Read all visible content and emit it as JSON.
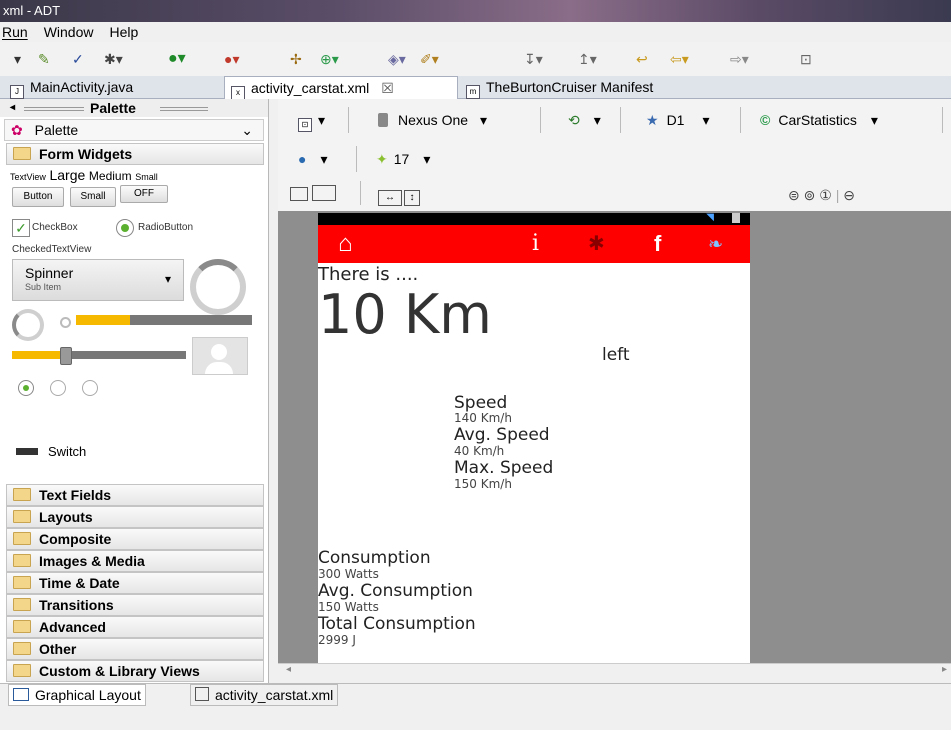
{
  "window": {
    "title": "xml - ADT"
  },
  "menu": {
    "items": [
      "Run",
      "Window",
      "Help"
    ]
  },
  "toolbar": {
    "icons": [
      "dropdown-arrow",
      "new-android-class-icon",
      "android-lint-icon",
      "debug-icon",
      "run-icon",
      "external-tools-icon",
      "new-project-icon",
      "new-class-icon",
      "open-type-icon",
      "search-icon",
      "next-annotation-icon",
      "prev-annotation-icon",
      "back-icon",
      "forward-icon",
      "pin-editor-icon"
    ]
  },
  "tabs": [
    {
      "label": "MainActivity.java",
      "icon": "J"
    },
    {
      "label": "activity_carstat.xml",
      "icon": "x",
      "close": "☒"
    },
    {
      "label": "TheBurtonCruiser Manifest",
      "icon": "m"
    }
  ],
  "palette": {
    "header": "Palette",
    "dropdown_label": "Palette",
    "open_category": "Form Widgets",
    "widgets": {
      "textview": "TextView",
      "large": "Large",
      "medium": "Medium",
      "small": "Small",
      "button": "Button",
      "small_button": "Small",
      "toggle": "OFF",
      "checkbox": "CheckBox",
      "radiobutton": "RadioButton",
      "checkedtextview": "CheckedTextView",
      "spinner": "Spinner",
      "spinner_sub": "Sub Item",
      "switch": "Switch"
    },
    "categories": [
      "Text Fields",
      "Layouts",
      "Composite",
      "Images & Media",
      "Time & Date",
      "Transitions",
      "Advanced",
      "Other",
      "Custom & Library Views"
    ]
  },
  "editor": {
    "device": "Nexus One",
    "theme": "D1",
    "activity": "CarStatistics",
    "api": "17"
  },
  "preview": {
    "header_line": "There is ....",
    "distance": "10 Km",
    "left_label": "left",
    "speed_label": "Speed",
    "speed_value": "140 Km/h",
    "avg_speed_label": "Avg. Speed",
    "avg_speed_value": "40 Km/h",
    "max_speed_label": "Max. Speed",
    "max_speed_value": "150 Km/h",
    "consumption_label": "Consumption",
    "consumption_value": "300 Watts",
    "avg_consumption_label": "Avg. Consumption",
    "avg_consumption_value": "150 Watts",
    "total_consumption_label": "Total Consumption",
    "total_consumption_value": "2999 J",
    "appbar_icons": {
      "home": "home-icon",
      "info": "i",
      "bluetooth": "bluetooth-icon",
      "facebook": "f",
      "twitter": "twitter-icon"
    },
    "colors": {
      "appbar": "#ff0000",
      "text": "#222222"
    }
  },
  "bottom_tabs": [
    "Graphical Layout",
    "activity_carstat.xml"
  ]
}
